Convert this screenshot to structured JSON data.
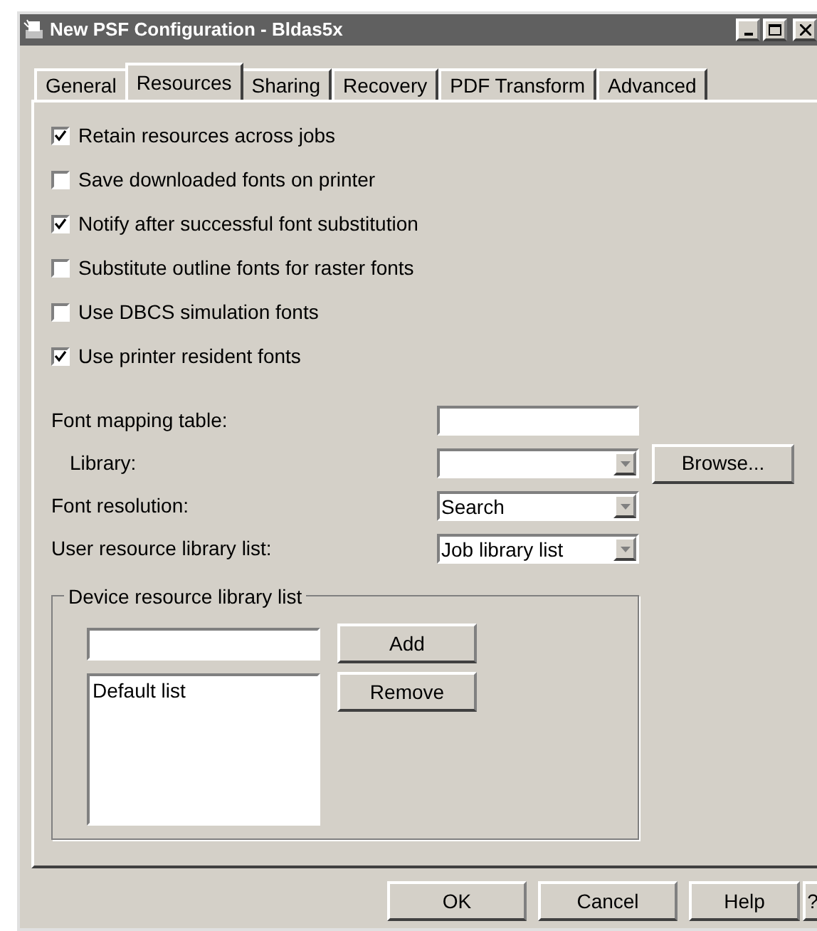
{
  "window": {
    "title": "New PSF Configuration - Bldas5x"
  },
  "tabs": [
    {
      "label": "General",
      "selected": false
    },
    {
      "label": "Resources",
      "selected": true
    },
    {
      "label": "Sharing",
      "selected": false
    },
    {
      "label": "Recovery",
      "selected": false
    },
    {
      "label": "PDF Transform",
      "selected": false
    },
    {
      "label": "Advanced",
      "selected": false
    }
  ],
  "options": [
    {
      "label": "Retain resources across jobs",
      "checked": true
    },
    {
      "label": "Save downloaded fonts on printer",
      "checked": false
    },
    {
      "label": "Notify after successful font substitution",
      "checked": true
    },
    {
      "label": "Substitute outline fonts for raster fonts",
      "checked": false
    },
    {
      "label": "Use DBCS simulation fonts",
      "checked": false
    },
    {
      "label": "Use printer resident fonts",
      "checked": true
    }
  ],
  "fields": [
    {
      "kind": "text",
      "label": "Font mapping table:",
      "indent": false
    },
    {
      "kind": "dropdown",
      "label": "Library:",
      "indent": true,
      "button": "Browse..."
    },
    {
      "kind": "dropdown",
      "label": "Font resolution:",
      "indent": false,
      "value": "Search"
    },
    {
      "kind": "dropdown",
      "label": "User resource library list:",
      "indent": false,
      "value": "Job library list"
    }
  ],
  "device_group": {
    "title": "Device resource library list",
    "list_items": [
      "Default list"
    ],
    "buttons": [
      "Add",
      "Remove"
    ]
  },
  "buttons": [
    "OK",
    "Cancel",
    "Help",
    "?"
  ]
}
